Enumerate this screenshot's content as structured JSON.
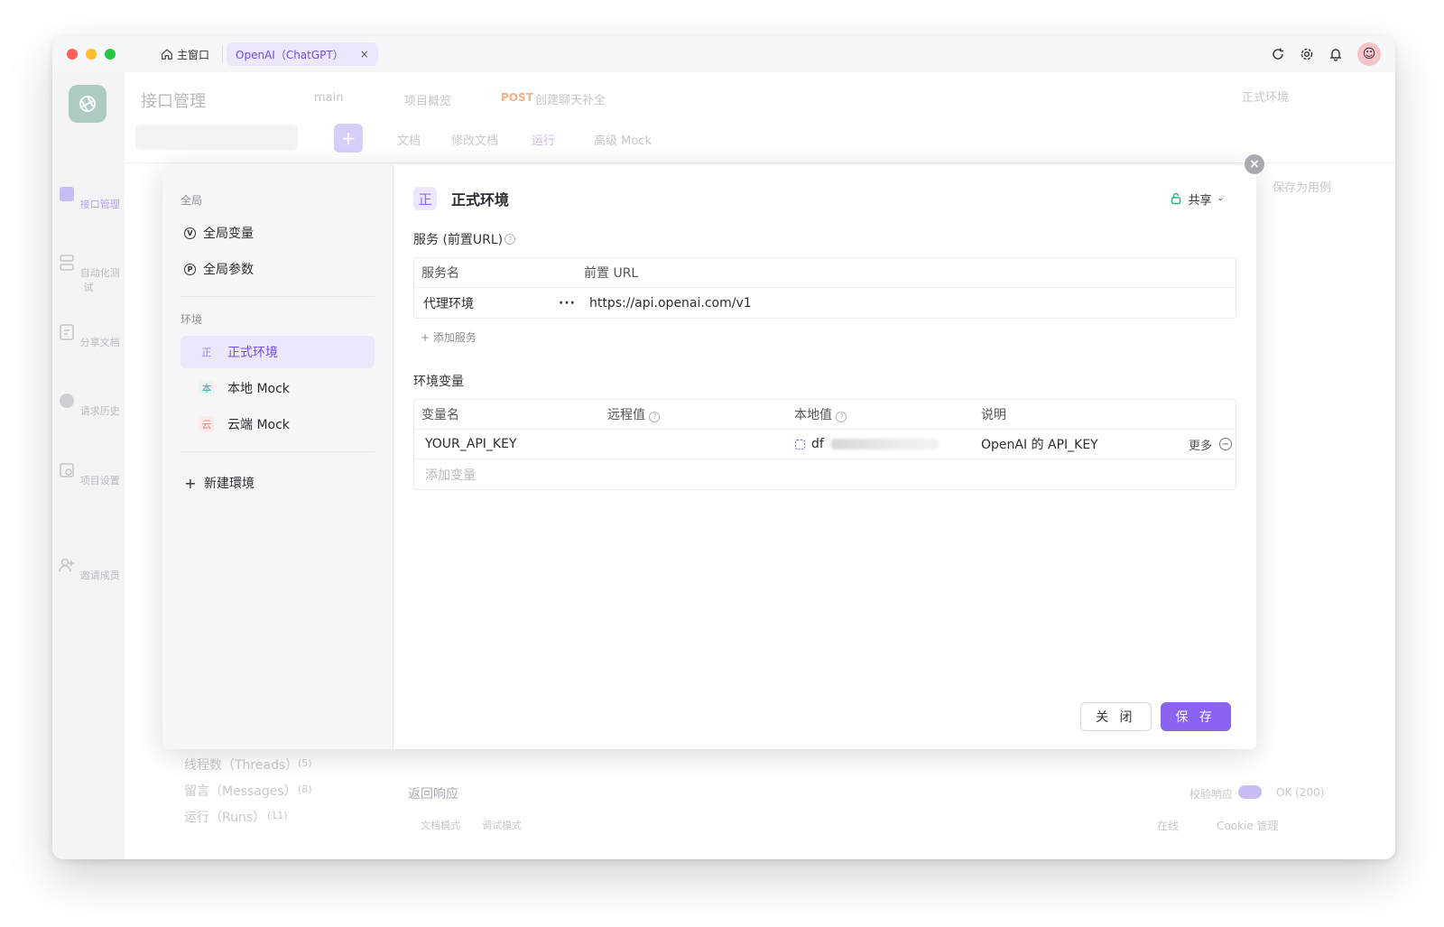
{
  "titlebar": {
    "home_tab": "主窗口",
    "app_tab": "OpenAI（ChatGPT）",
    "close_glyph": "×"
  },
  "rail": {
    "items": [
      "接口管理",
      "自动化测试",
      "分享文档",
      "请求历史",
      "项目设置",
      "邀请成员"
    ]
  },
  "background": {
    "page_title": "接口管理",
    "branch": "main",
    "tabs": [
      "项目概览",
      "POST",
      "创建聊天补全"
    ],
    "subtabs": [
      "文档",
      "修改文档",
      "运行",
      "高级 Mock"
    ],
    "env_selector": "正式环境",
    "save_as_case": "保存为用例",
    "folders": [
      "线程数（Threads）",
      "留言（Messages）",
      "运行（Runs）"
    ],
    "folder_counts": [
      "(5)",
      "(8)",
      "(11)"
    ],
    "return_response": "返回响应",
    "doc_mode": "文档模式",
    "debug_mode": "调试模式",
    "validate_response": "校验响应",
    "status": "OK (200)",
    "online": "在线",
    "cookie": "Cookie 管理"
  },
  "modal": {
    "sidebar": {
      "global_section": "全局",
      "global_items": [
        {
          "icon": "V",
          "label": "全局变量"
        },
        {
          "icon": "P",
          "label": "全局参数"
        }
      ],
      "env_section": "环境",
      "environments": [
        {
          "badge": "正",
          "label": "正式环境"
        },
        {
          "badge": "本",
          "label": "本地 Mock"
        },
        {
          "badge": "云",
          "label": "云端 Mock"
        }
      ],
      "new_env": "新建環境"
    },
    "header": {
      "badge": "正",
      "title": "正式环境",
      "share": "共享"
    },
    "services": {
      "label": "服务 (前置URL)",
      "col_name": "服务名",
      "col_url": "前置 URL",
      "rows": [
        {
          "name": "代理环境",
          "url": "https://api.openai.com/v1"
        }
      ],
      "add": "+ 添加服务"
    },
    "variables": {
      "label": "环境变量",
      "col_name": "变量名",
      "col_remote": "远程值",
      "col_local": "本地值",
      "col_desc": "说明",
      "rows": [
        {
          "name": "YOUR_API_KEY",
          "local_prefix": "df",
          "desc": "OpenAI 的 API_KEY",
          "more": "更多"
        }
      ],
      "add_placeholder": "添加变量"
    },
    "footer": {
      "close": "关 闭",
      "save": "保 存"
    }
  },
  "colors": {
    "accent": "#8b63f1",
    "accent_light": "#ece7fb"
  }
}
